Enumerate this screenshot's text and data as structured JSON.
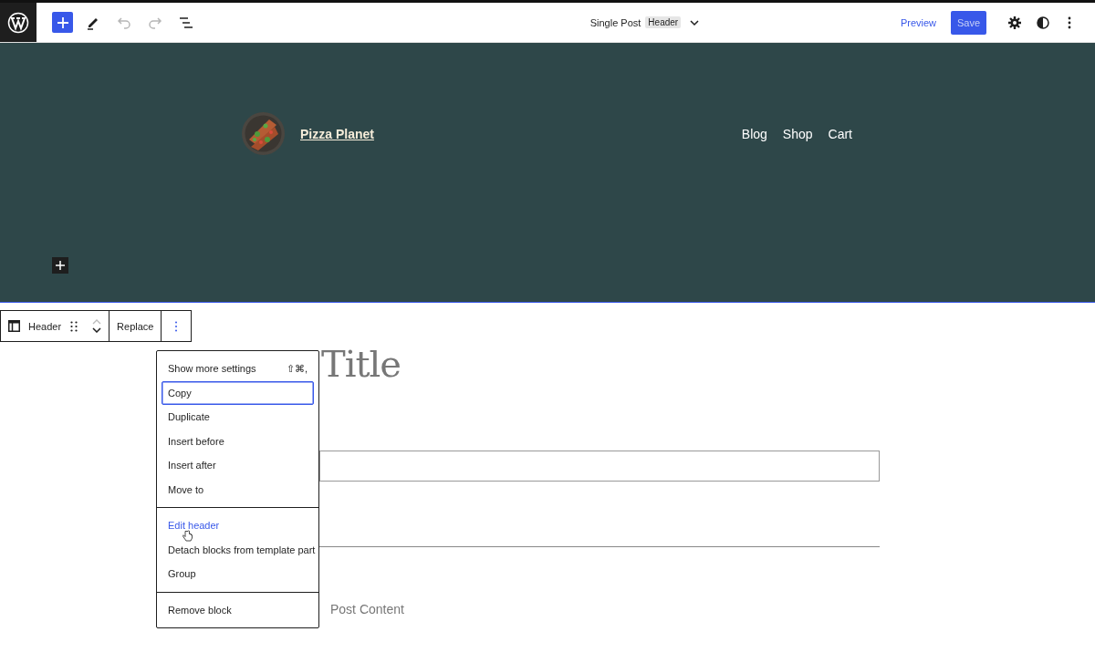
{
  "topbar": {
    "tools": [
      {
        "kind": "add",
        "disabled": false
      },
      {
        "kind": "edit",
        "disabled": false
      },
      {
        "kind": "undo",
        "disabled": true
      },
      {
        "kind": "redo",
        "disabled": true
      },
      {
        "kind": "outline",
        "disabled": false
      }
    ],
    "document": {
      "title": "Single Post",
      "badge": "Header"
    },
    "preview": "Preview",
    "save": {
      "label": "Save",
      "disabled": true
    }
  },
  "site_header": {
    "site_title": "Pizza Planet",
    "nav": [
      "Blog",
      "Shop",
      "Cart"
    ]
  },
  "block_toolbar": {
    "block": "Header",
    "replace": "Replace"
  },
  "content": {
    "title": "Title",
    "post_content": "Post Content"
  },
  "menu": {
    "groups": [
      [
        {
          "label": "Show more settings",
          "shortcut": "⇧⌘,",
          "focused": false,
          "highlighted": false
        },
        {
          "label": "Copy",
          "focused": true,
          "highlighted": false
        },
        {
          "label": "Duplicate",
          "focused": false,
          "highlighted": false
        },
        {
          "label": "Insert before",
          "focused": false,
          "highlighted": false
        },
        {
          "label": "Insert after",
          "focused": false,
          "highlighted": false
        },
        {
          "label": "Move to",
          "focused": false,
          "highlighted": false
        }
      ],
      [
        {
          "label": "Edit header",
          "focused": false,
          "highlighted": true
        },
        {
          "label": "Detach blocks from template part",
          "focused": false,
          "highlighted": false
        },
        {
          "label": "Group",
          "focused": false,
          "highlighted": false
        }
      ],
      [
        {
          "label": "Remove block",
          "focused": false,
          "highlighted": false
        }
      ]
    ]
  }
}
